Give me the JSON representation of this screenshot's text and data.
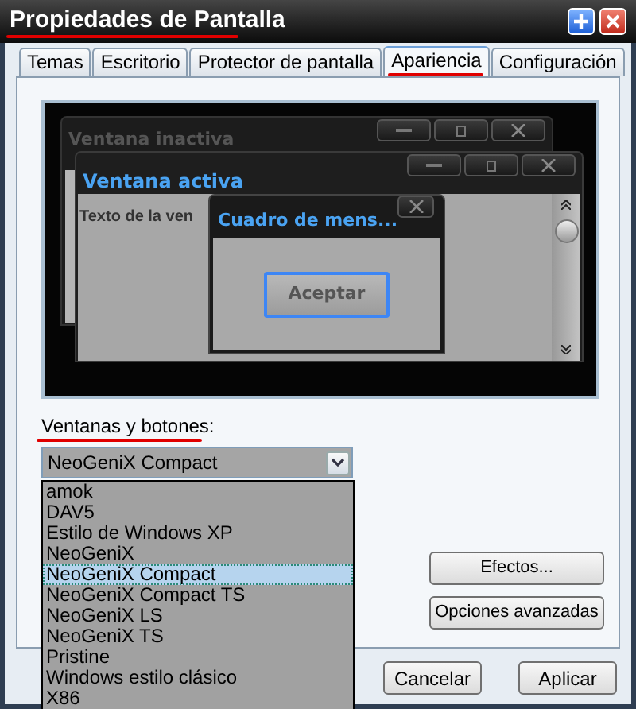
{
  "window": {
    "title": "Propiedades de Pantalla"
  },
  "tabs": [
    {
      "label": "Temas",
      "selected": false
    },
    {
      "label": "Escritorio",
      "selected": false
    },
    {
      "label": "Protector de pantalla",
      "selected": false
    },
    {
      "label": "Apariencia",
      "selected": true
    },
    {
      "label": "Configuración",
      "selected": false
    }
  ],
  "preview": {
    "inactive_window": {
      "title": "Ventana inactiva"
    },
    "active_window": {
      "title": "Ventana activa",
      "text": "Texto de la ven"
    },
    "message_box": {
      "title": "Cuadro de mens...",
      "button": "Aceptar"
    }
  },
  "windows_and_buttons": {
    "label": "Ventanas y botones:",
    "value": "NeoGeniX Compact",
    "expanded": true,
    "options": [
      {
        "label": "amok",
        "selected": false
      },
      {
        "label": "DAV5",
        "selected": false
      },
      {
        "label": "Estilo de Windows XP",
        "selected": false
      },
      {
        "label": "NeoGeniX",
        "selected": false
      },
      {
        "label": "NeoGeniX Compact",
        "selected": true
      },
      {
        "label": "NeoGeniX Compact TS",
        "selected": false
      },
      {
        "label": "NeoGeniX LS",
        "selected": false
      },
      {
        "label": "NeoGeniX TS",
        "selected": false
      },
      {
        "label": "Pristine",
        "selected": false
      },
      {
        "label": "Windows estilo clásico",
        "selected": false
      },
      {
        "label": "X86",
        "selected": false
      }
    ]
  },
  "side_buttons": [
    "Efectos...",
    "Opciones avanzadas"
  ],
  "dialog_buttons": [
    "Cancelar",
    "Aplicar"
  ]
}
